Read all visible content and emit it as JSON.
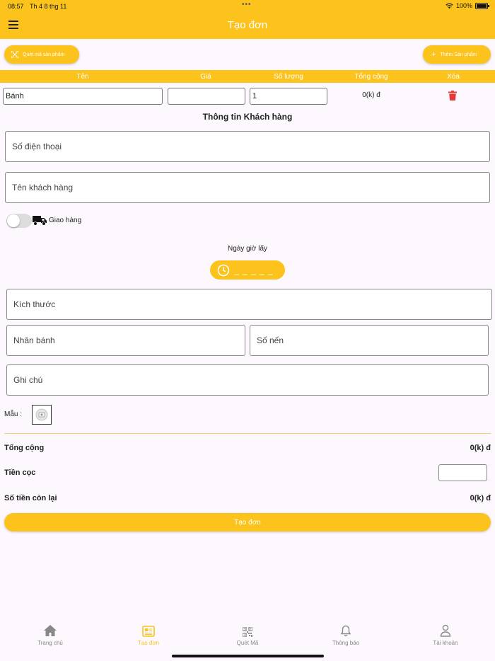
{
  "status_bar": {
    "time": "08:57",
    "date": "Th 4 8 thg 11",
    "battery": "100%"
  },
  "app_bar": {
    "title": "Tạo đơn"
  },
  "actions": {
    "scan_label": "Quét mã sản phẩm",
    "add_label": "Thêm Sản phẩm"
  },
  "table": {
    "headers": [
      "Tên",
      "Giá",
      "Số lượng",
      "Tổng cộng",
      "Xóa"
    ],
    "row": {
      "name": "Bánh",
      "price": "",
      "quantity": "1",
      "total": "0(k) đ"
    }
  },
  "customer": {
    "section_title": "Thông tin Khách hàng",
    "phone_placeholder": "Số điện thoại",
    "name_placeholder": "Tên khách hàng"
  },
  "delivery": {
    "label": "Giao hàng",
    "enabled": false
  },
  "pickup": {
    "label": "Ngày giờ lấy",
    "time_placeholder": "_ _ _ _ _"
  },
  "cake": {
    "size_placeholder": "Kích thước",
    "filling_placeholder": "Nhân bánh",
    "candles_placeholder": "Số nến",
    "note_placeholder": "Ghi chú"
  },
  "sample_label": "Mẫu :",
  "summary": {
    "total_label": "Tổng cộng",
    "total_value": "0(k) đ",
    "deposit_label": "Tiền cọc",
    "deposit_value": "",
    "remaining_label": "Số tiền còn lại",
    "remaining_value": "0(k) đ"
  },
  "submit_label": "Tạo đơn",
  "bottom_nav": [
    {
      "label": "Trang chủ",
      "icon": "home-icon",
      "active": false
    },
    {
      "label": "Tạo đơn",
      "icon": "newspaper-icon",
      "active": true
    },
    {
      "label": "Quét Mã",
      "icon": "qr-code-icon",
      "active": false
    },
    {
      "label": "Thông báo",
      "icon": "bell-icon",
      "active": false
    },
    {
      "label": "Tài khoản",
      "icon": "person-icon",
      "active": false
    }
  ],
  "colors": {
    "accent": "#fbc31b",
    "delete": "#e53935",
    "background": "#fdf8fd"
  }
}
